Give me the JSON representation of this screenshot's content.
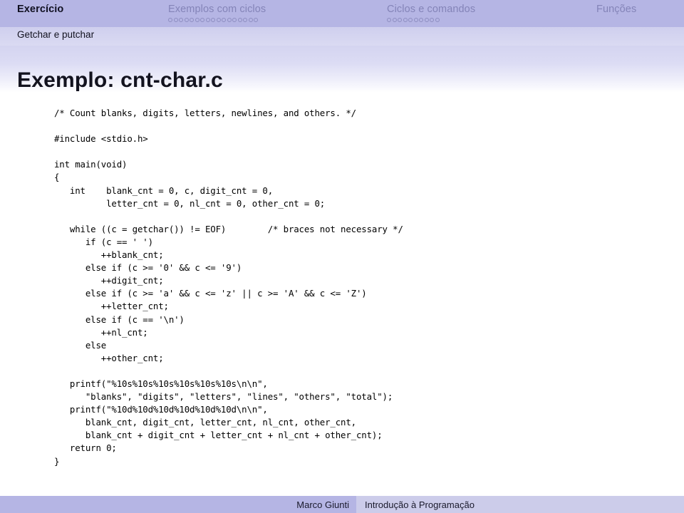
{
  "colors": {
    "header_bg": "#b5b5e4",
    "subsection_bg": "#d5d5f0",
    "footer_author_bg": "#b5b5e4",
    "footer_title_bg": "#ccccea",
    "nav_active_text": "#111122",
    "nav_inactive_text": "#8484b8",
    "dot_border": "#8d8dc0",
    "code_text": "#000000"
  },
  "header": {
    "sections": [
      {
        "label": "Exercício",
        "dots": 0,
        "active": true
      },
      {
        "label": "Exemplos com ciclos",
        "dots": 17,
        "active": false
      },
      {
        "label": "Ciclos e comandos",
        "dots": 10,
        "active": false
      },
      {
        "label": "Funções",
        "dots": 0,
        "active": false
      }
    ]
  },
  "subsection": {
    "title": "Getchar e putchar"
  },
  "frame": {
    "title": "Exemplo: cnt-char.c"
  },
  "code": {
    "language": "c",
    "lines": [
      "/* Count blanks, digits, letters, newlines, and others. */",
      "",
      "#include <stdio.h>",
      "",
      "int main(void)",
      "{",
      "   int    blank_cnt = 0, c, digit_cnt = 0,",
      "          letter_cnt = 0, nl_cnt = 0, other_cnt = 0;",
      "",
      "   while ((c = getchar()) != EOF)        /* braces not necessary */",
      "      if (c == ' ')",
      "         ++blank_cnt;",
      "      else if (c >= '0' && c <= '9')",
      "         ++digit_cnt;",
      "      else if (c >= 'a' && c <= 'z' || c >= 'A' && c <= 'Z')",
      "         ++letter_cnt;",
      "      else if (c == '\\n')",
      "         ++nl_cnt;",
      "      else",
      "         ++other_cnt;",
      "",
      "   printf(\"%10s%10s%10s%10s%10s%10s\\n\\n\",",
      "      \"blanks\", \"digits\", \"letters\", \"lines\", \"others\", \"total\");",
      "   printf(\"%10d%10d%10d%10d%10d%10d\\n\\n\",",
      "      blank_cnt, digit_cnt, letter_cnt, nl_cnt, other_cnt,",
      "      blank_cnt + digit_cnt + letter_cnt + nl_cnt + other_cnt);",
      "   return 0;",
      "}"
    ]
  },
  "footer": {
    "author": "Marco Giunti",
    "title": "Introdução à Programação"
  }
}
